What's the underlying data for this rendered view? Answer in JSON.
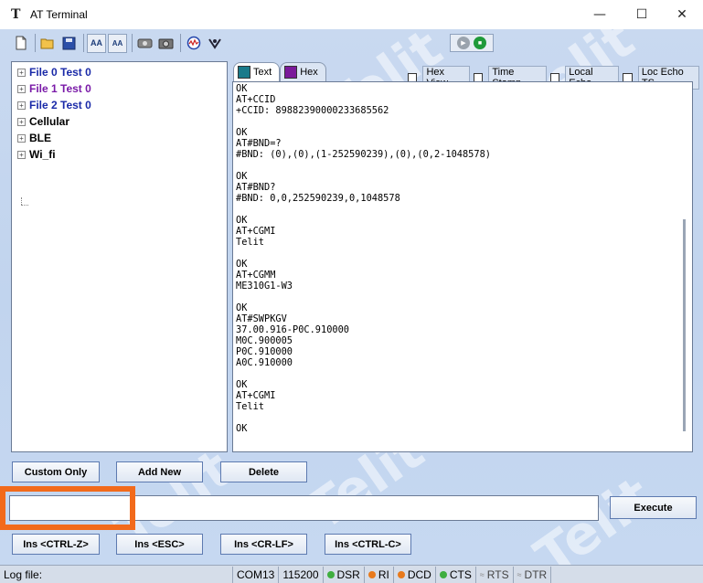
{
  "window": {
    "title": "AT Terminal",
    "app_icon_glyph": "T",
    "minimize_glyph": "—",
    "maximize_glyph": "☐",
    "close_glyph": "✕"
  },
  "toolbar": {
    "icons": [
      "new-file-icon",
      "open-folder-icon",
      "save-icon",
      "font-larger-icon",
      "font-smaller-icon",
      "connect-icon",
      "camera-icon",
      "scope-icon",
      "settings-icon"
    ],
    "font_larger_label": "AA",
    "font_smaller_label": "AA"
  },
  "tree": {
    "items": [
      {
        "label": "File 0 Test 0",
        "color": "#1a2aa8"
      },
      {
        "label": "File 1 Test 0",
        "color": "#7a1aa8"
      },
      {
        "label": "File 2 Test 0",
        "color": "#1a2aa8"
      },
      {
        "label": "Cellular",
        "color": "#000000"
      },
      {
        "label": "BLE",
        "color": "#000000"
      },
      {
        "label": "Wi_fi",
        "color": "#000000"
      }
    ]
  },
  "tabs": {
    "text_label": "Text",
    "hex_label": "Hex",
    "text_color": "#1a7a8a",
    "hex_color": "#7a1a9a"
  },
  "options": {
    "hex_view": "Hex View",
    "time_stamp": "Time Stamp",
    "local_echo": "Local Echo",
    "loc_echo_ts": "Loc Echo TS"
  },
  "output": {
    "text": "OK\nAT+CCID\n+CCID: 89882390000233685562\n\nOK\nAT#BND=?\n#BND: (0),(0),(1-252590239),(0),(0,2-1048578)\n\nOK\nAT#BND?\n#BND: 0,0,252590239,0,1048578\n\nOK\nAT+CGMI\nTelit\n\nOK\nAT+CGMM\nME310G1-W3\n\nOK\nAT#SWPKGV\n37.00.916-P0C.910000\nM0C.900005\nP0C.910000\nA0C.910000\n\nOK\nAT+CGMI\nTelit\n\nOK"
  },
  "buttons": {
    "custom_only": "Custom Only",
    "add_new": "Add New",
    "delete": "Delete",
    "execute": "Execute",
    "ins_ctrl_z": "Ins <CTRL-Z>",
    "ins_esc": "Ins <ESC>",
    "ins_cr_lf": "Ins <CR-LF>",
    "ins_ctrl_c": "Ins <CTRL-C>"
  },
  "command": {
    "value": ""
  },
  "watermark": {
    "text": "Telit"
  },
  "status": {
    "log_file": "Log file:",
    "port": "COM13",
    "baud": "115200",
    "dsr": "DSR",
    "ri": "RI",
    "dcd": "DCD",
    "cts": "CTS",
    "rts": "RTS",
    "dtr": "DTR"
  },
  "colors": {
    "highlight": "#f26a1b",
    "led_green": "#3fae3f",
    "led_orange": "#e87a1c"
  }
}
